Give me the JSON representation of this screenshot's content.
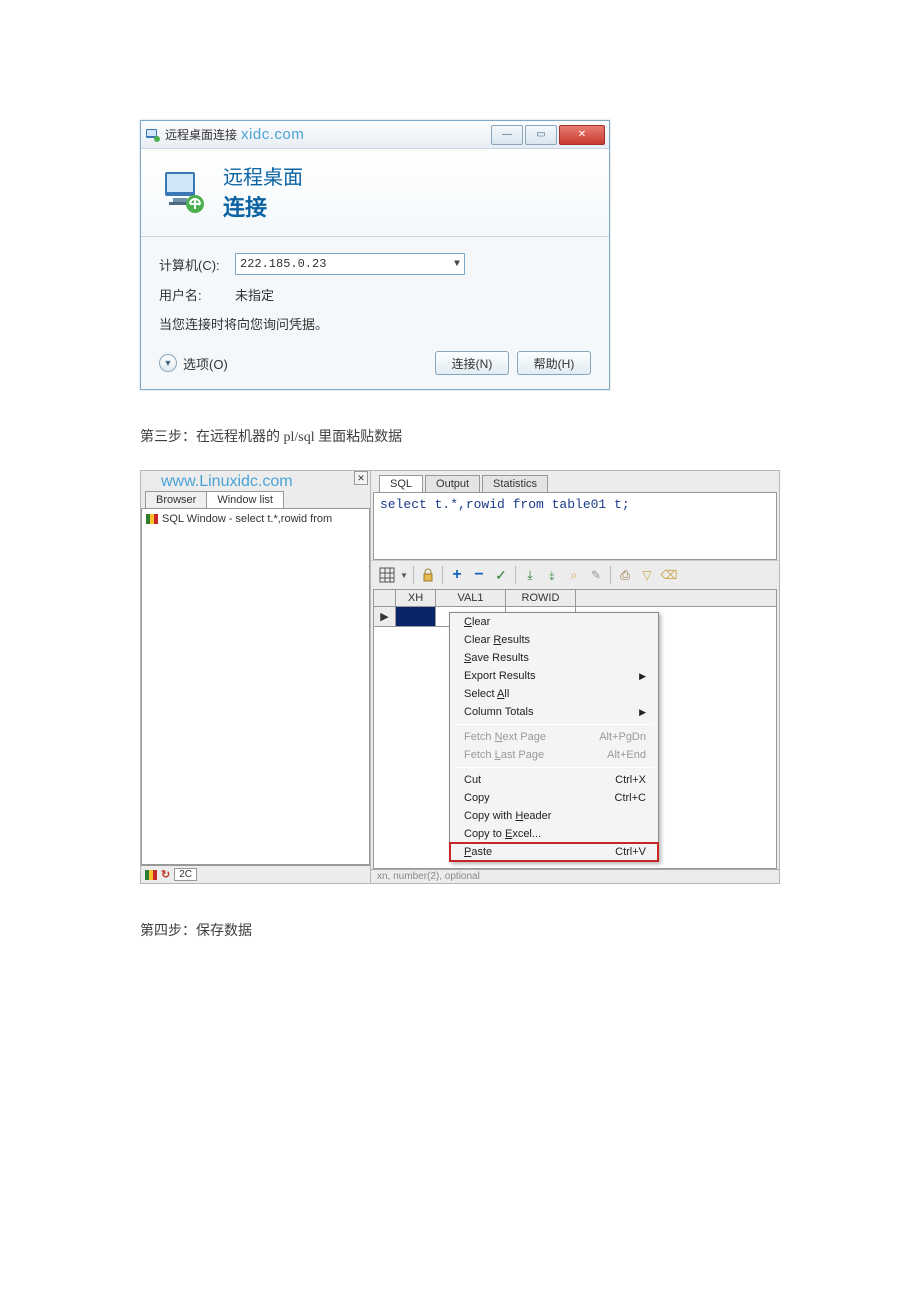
{
  "rdp": {
    "titlebar": {
      "title": "远程桌面连接",
      "watermark": "xidc.com"
    },
    "header": {
      "line1": "远程桌面",
      "line2": "连接"
    },
    "labels": {
      "computer": "计算机(C):",
      "username": "用户名:",
      "user_unset": "未指定",
      "note": "当您连接时将向您询问凭据。"
    },
    "computer_value": "222.185.0.23",
    "footer": {
      "options": "选项(O)",
      "connect": "连接(N)",
      "help": "帮助(H)"
    }
  },
  "step3": "第三步：在远程机器的 pl/sql 里面粘贴数据",
  "plsql": {
    "watermark": "www.Linuxidc.com",
    "side_tabs": {
      "browser": "Browser",
      "windowlist": "Window list"
    },
    "tree_item": "SQL Window - select t.*,rowid from",
    "status": {
      "mode": "2C"
    },
    "main_tabs": {
      "sql": "SQL",
      "output": "Output",
      "stats": "Statistics"
    },
    "sql_text": "select t.*,rowid from table01 t;",
    "grid": {
      "cols": {
        "xh": "XH",
        "val1": "VAL1",
        "rowid": "ROWID"
      }
    },
    "context_menu": {
      "clear": "Clear",
      "clear_results": "Clear Results",
      "save_results": "Save Results",
      "export_results": "Export Results",
      "select_all": "Select All",
      "column_totals": "Column Totals",
      "fetch_next": "Fetch Next Page",
      "fetch_next_sc": "Alt+PgDn",
      "fetch_last": "Fetch Last Page",
      "fetch_last_sc": "Alt+End",
      "cut": "Cut",
      "cut_sc": "Ctrl+X",
      "copy": "Copy",
      "copy_sc": "Ctrl+C",
      "copy_header": "Copy with Header",
      "copy_excel": "Copy to Excel...",
      "paste": "Paste",
      "paste_sc": "Ctrl+V"
    },
    "bottom_hint": "xn, number(2), optional"
  },
  "step4": "第四步：保存数据"
}
